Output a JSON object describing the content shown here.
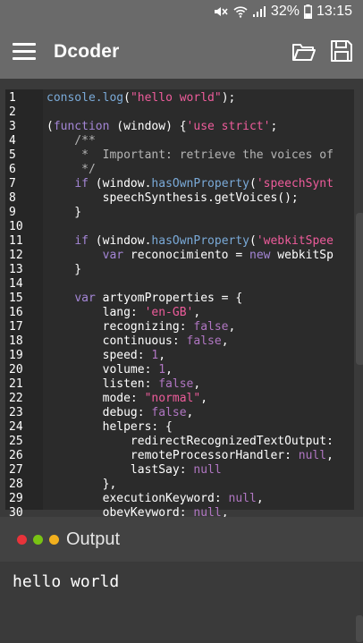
{
  "status": {
    "battery": "32%",
    "time": "13:15"
  },
  "appbar": {
    "title": "Dcoder",
    "icons": [
      "menu-icon",
      "folder-open-icon",
      "save-icon"
    ]
  },
  "editor": {
    "line_numbers": [
      "1",
      "2",
      "3",
      "4",
      "5",
      "6",
      "7",
      "8",
      "9",
      "10",
      "11",
      "12",
      "13",
      "14",
      "15",
      "16",
      "17",
      "18",
      "19",
      "20",
      "21",
      "22",
      "23",
      "24",
      "25",
      "26",
      "27",
      "28",
      "29",
      "30"
    ],
    "lines": [
      [
        {
          "t": "console.",
          "c": "fn"
        },
        {
          "t": "log",
          "c": "fn"
        },
        {
          "t": "(",
          "c": ""
        },
        {
          "t": "\"hello world\"",
          "c": "str"
        },
        {
          "t": ");",
          "c": ""
        }
      ],
      [],
      [
        {
          "t": "(",
          "c": ""
        },
        {
          "t": "function",
          "c": "kw"
        },
        {
          "t": " (window) {",
          "c": ""
        },
        {
          "t": "'use strict'",
          "c": "str"
        },
        {
          "t": ";",
          "c": ""
        }
      ],
      [
        {
          "t": "    /**",
          "c": "cm"
        }
      ],
      [
        {
          "t": "     *  Important: retrieve the voices of",
          "c": "cm"
        }
      ],
      [
        {
          "t": "     */",
          "c": "cm"
        }
      ],
      [
        {
          "t": "    ",
          "c": ""
        },
        {
          "t": "if",
          "c": "kw"
        },
        {
          "t": " (window.",
          "c": ""
        },
        {
          "t": "hasOwnProperty",
          "c": "fn"
        },
        {
          "t": "(",
          "c": ""
        },
        {
          "t": "'speechSynt",
          "c": "str"
        }
      ],
      [
        {
          "t": "        speechSynthesis.getVoices();",
          "c": ""
        }
      ],
      [
        {
          "t": "    }",
          "c": ""
        }
      ],
      [],
      [
        {
          "t": "    ",
          "c": ""
        },
        {
          "t": "if",
          "c": "kw"
        },
        {
          "t": " (window.",
          "c": ""
        },
        {
          "t": "hasOwnProperty",
          "c": "fn"
        },
        {
          "t": "(",
          "c": ""
        },
        {
          "t": "'webkitSpee",
          "c": "str"
        }
      ],
      [
        {
          "t": "        ",
          "c": ""
        },
        {
          "t": "var",
          "c": "kw"
        },
        {
          "t": " reconocimiento = ",
          "c": ""
        },
        {
          "t": "new",
          "c": "kw"
        },
        {
          "t": " webkitSp",
          "c": ""
        }
      ],
      [
        {
          "t": "    }",
          "c": ""
        }
      ],
      [],
      [
        {
          "t": "    ",
          "c": ""
        },
        {
          "t": "var",
          "c": "kw"
        },
        {
          "t": " artyomProperties = {",
          "c": ""
        }
      ],
      [
        {
          "t": "        lang: ",
          "c": ""
        },
        {
          "t": "'en-GB'",
          "c": "str"
        },
        {
          "t": ",",
          "c": ""
        }
      ],
      [
        {
          "t": "        recognizing: ",
          "c": ""
        },
        {
          "t": "false",
          "c": "bool"
        },
        {
          "t": ",",
          "c": ""
        }
      ],
      [
        {
          "t": "        continuous: ",
          "c": ""
        },
        {
          "t": "false",
          "c": "bool"
        },
        {
          "t": ",",
          "c": ""
        }
      ],
      [
        {
          "t": "        speed: ",
          "c": ""
        },
        {
          "t": "1",
          "c": "num"
        },
        {
          "t": ",",
          "c": ""
        }
      ],
      [
        {
          "t": "        volume: ",
          "c": ""
        },
        {
          "t": "1",
          "c": "num"
        },
        {
          "t": ",",
          "c": ""
        }
      ],
      [
        {
          "t": "        listen: ",
          "c": ""
        },
        {
          "t": "false",
          "c": "bool"
        },
        {
          "t": ",",
          "c": ""
        }
      ],
      [
        {
          "t": "        mode: ",
          "c": ""
        },
        {
          "t": "\"normal\"",
          "c": "str"
        },
        {
          "t": ",",
          "c": ""
        }
      ],
      [
        {
          "t": "        debug: ",
          "c": ""
        },
        {
          "t": "false",
          "c": "bool"
        },
        {
          "t": ",",
          "c": ""
        }
      ],
      [
        {
          "t": "        helpers: {",
          "c": ""
        }
      ],
      [
        {
          "t": "            redirectRecognizedTextOutput:",
          "c": ""
        }
      ],
      [
        {
          "t": "            remoteProcessorHandler: ",
          "c": ""
        },
        {
          "t": "null",
          "c": "bool"
        },
        {
          "t": ",",
          "c": ""
        }
      ],
      [
        {
          "t": "            lastSay: ",
          "c": ""
        },
        {
          "t": "null",
          "c": "bool"
        }
      ],
      [
        {
          "t": "        },",
          "c": ""
        }
      ],
      [
        {
          "t": "        executionKeyword: ",
          "c": ""
        },
        {
          "t": "null",
          "c": "bool"
        },
        {
          "t": ",",
          "c": ""
        }
      ],
      [
        {
          "t": "        obeyKeyword: ",
          "c": ""
        },
        {
          "t": "null",
          "c": "bool"
        },
        {
          "t": ",",
          "c": ""
        }
      ]
    ]
  },
  "output": {
    "title": "Output",
    "text": "hello world",
    "colors": {
      "red": "#e8333a",
      "green": "#79c314",
      "yellow": "#f2b01e"
    }
  }
}
